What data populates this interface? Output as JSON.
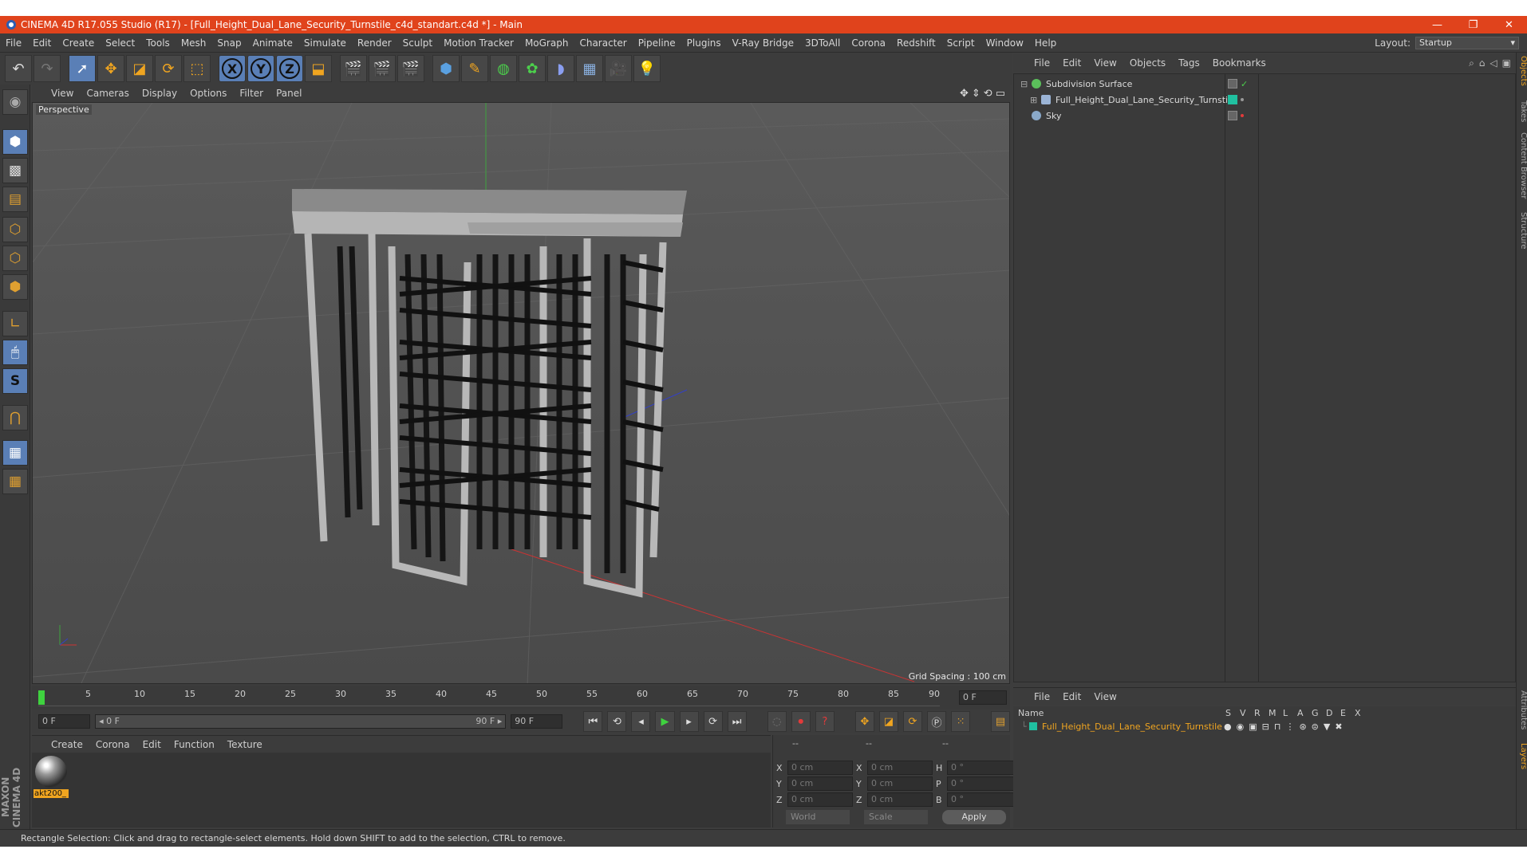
{
  "window": {
    "title": "CINEMA 4D R17.055 Studio (R17) - [Full_Height_Dual_Lane_Security_Turnstile_c4d_standart.c4d *] - Main",
    "min": "—",
    "max": "❐",
    "close": "✕"
  },
  "menubar": {
    "items": [
      "File",
      "Edit",
      "Create",
      "Select",
      "Tools",
      "Mesh",
      "Snap",
      "Animate",
      "Simulate",
      "Render",
      "Sculpt",
      "Motion Tracker",
      "MoGraph",
      "Character",
      "Pipeline",
      "Plugins",
      "V-Ray Bridge",
      "3DToAll",
      "Corona",
      "Redshift",
      "Script",
      "Window",
      "Help"
    ],
    "layout_label": "Layout:",
    "layout_value": "Startup"
  },
  "viewport": {
    "menu": [
      "View",
      "Cameras",
      "Display",
      "Options",
      "Filter",
      "Panel"
    ],
    "label": "Perspective",
    "grid_spacing": "Grid Spacing : 100 cm"
  },
  "timeline": {
    "ticks": [
      "0",
      "5",
      "10",
      "15",
      "20",
      "25",
      "30",
      "35",
      "40",
      "45",
      "50",
      "55",
      "60",
      "65",
      "70",
      "75",
      "80",
      "85",
      "90"
    ],
    "current_frame": "0 F",
    "start_field": "0 F",
    "range_start": "◂ 0 F",
    "range_end": "90 F ▸",
    "end_field": "90 F"
  },
  "material_manager": {
    "menu": [
      "Create",
      "Corona",
      "Edit",
      "Function",
      "Texture"
    ],
    "material_name": "akt200_"
  },
  "branding": {
    "logo": "MAXON CINEMA 4D"
  },
  "coordinates": {
    "headers": [
      "--",
      "--",
      "--"
    ],
    "rows": [
      {
        "a": "X",
        "av": "0 cm",
        "b": "X",
        "bv": "0 cm",
        "c": "H",
        "cv": "0 °"
      },
      {
        "a": "Y",
        "av": "0 cm",
        "b": "Y",
        "bv": "0 cm",
        "c": "P",
        "cv": "0 °"
      },
      {
        "a": "Z",
        "av": "0 cm",
        "b": "Z",
        "bv": "0 cm",
        "c": "B",
        "cv": "0 °"
      }
    ],
    "space": "World",
    "mode": "Scale",
    "apply": "Apply"
  },
  "status": "Rectangle Selection: Click and drag to rectangle-select elements. Hold down SHIFT to add to the selection, CTRL to remove.",
  "object_manager": {
    "menu": [
      "File",
      "Edit",
      "View",
      "Objects",
      "Tags",
      "Bookmarks"
    ],
    "objects": [
      {
        "name": "Subdivision Surface",
        "color": "#5bc05b"
      },
      {
        "name": "Full_Height_Dual_Lane_Security_Turnstile",
        "color": "#9bb4d6"
      },
      {
        "name": "Sky",
        "color": "#8aa9c9"
      }
    ]
  },
  "layer_manager": {
    "menu": [
      "File",
      "Edit",
      "View"
    ],
    "columns": [
      "Name",
      "S",
      "V",
      "R",
      "M",
      "L",
      "A",
      "G",
      "D",
      "E",
      "X"
    ],
    "row_name": "Full_Height_Dual_Lane_Security_Turnstile",
    "accent": "#f0a520"
  },
  "right_tabs": [
    "Objects",
    "Takes",
    "Content Browser",
    "Structure",
    "Attributes",
    "Layers"
  ]
}
